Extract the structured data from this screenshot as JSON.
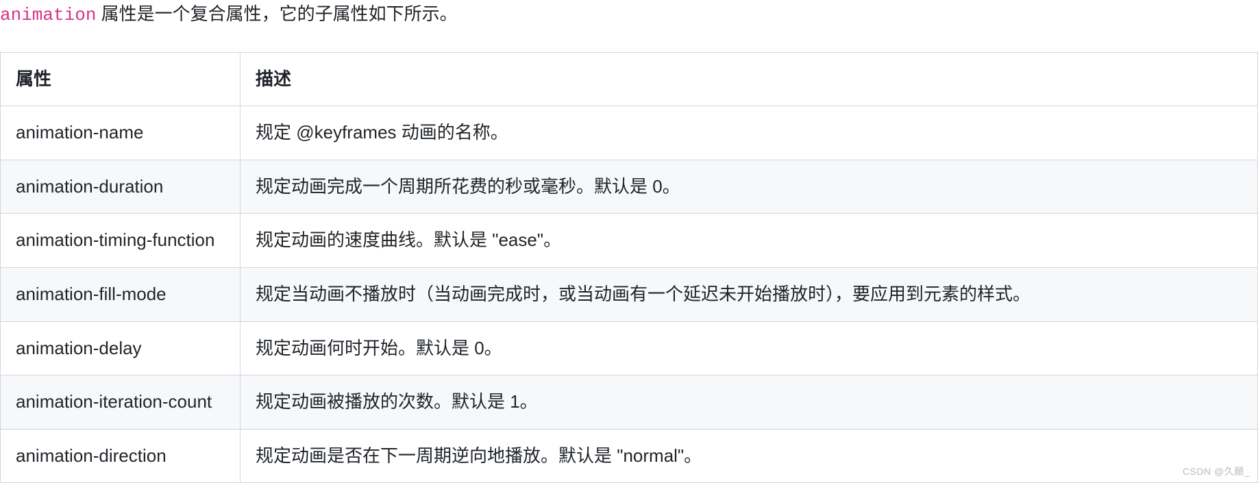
{
  "intro": {
    "code": "animation",
    "text": " 属性是一个复合属性，它的子属性如下所示。"
  },
  "table": {
    "headers": {
      "property": "属性",
      "description": "描述"
    },
    "rows": [
      {
        "property": "animation-name",
        "description": "规定 @keyframes 动画的名称。"
      },
      {
        "property": "animation-duration",
        "description": "规定动画完成一个周期所花费的秒或毫秒。默认是 0。"
      },
      {
        "property": "animation-timing-function",
        "description": "规定动画的速度曲线。默认是 \"ease\"。"
      },
      {
        "property": "animation-fill-mode",
        "description": "规定当动画不播放时（当动画完成时，或当动画有一个延迟未开始播放时），要应用到元素的样式。"
      },
      {
        "property": "animation-delay",
        "description": "规定动画何时开始。默认是 0。"
      },
      {
        "property": "animation-iteration-count",
        "description": "规定动画被播放的次数。默认是 1。"
      },
      {
        "property": "animation-direction",
        "description": "规定动画是否在下一周期逆向地播放。默认是 \"normal\"。"
      }
    ]
  },
  "watermark": "CSDN @久願_"
}
